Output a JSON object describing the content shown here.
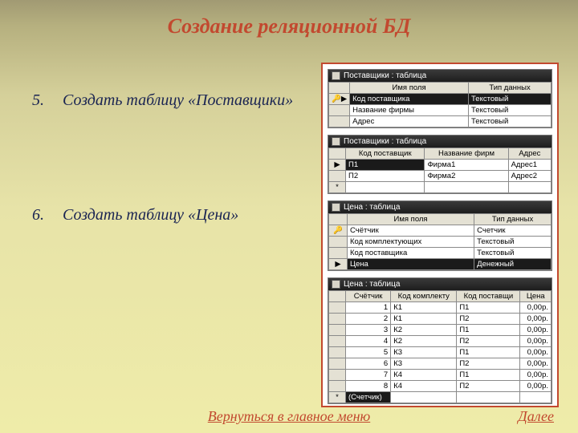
{
  "title": "Создание реляционной БД",
  "steps": [
    {
      "num": "5.",
      "text": "Создать таблицу «Поставщики»"
    },
    {
      "num": "6.",
      "text": "Создать таблицу «Цена»"
    }
  ],
  "nav": {
    "back": "Вернуться в главное меню",
    "next": "Далее"
  },
  "shot1": {
    "caption": "Поставщики : таблица",
    "headers": [
      "",
      "Имя поля",
      "Тип данных"
    ],
    "rows": [
      {
        "icon": "🔑▶",
        "f": "Код поставщика",
        "t": "Текстовый",
        "sel": true
      },
      {
        "icon": "",
        "f": "Название фирмы",
        "t": "Текстовый"
      },
      {
        "icon": "",
        "f": "Адрес",
        "t": "Текстовый"
      }
    ]
  },
  "shot2": {
    "caption": "Поставщики : таблица",
    "headers": [
      "",
      "Код поставщик",
      "Название фирм",
      "Адрес"
    ],
    "rows": [
      {
        "icon": "▶",
        "c": "П1",
        "n": "Фирма1",
        "a": "Адрес1",
        "sel": true
      },
      {
        "icon": "",
        "c": "П2",
        "n": "Фирма2",
        "a": "Адрес2"
      },
      {
        "icon": "*",
        "c": "",
        "n": "",
        "a": ""
      }
    ]
  },
  "shot3": {
    "caption": "Цена : таблица",
    "headers": [
      "",
      "Имя поля",
      "Тип данных"
    ],
    "rows": [
      {
        "icon": "🔑",
        "f": "Счётчик",
        "t": "Счетчик"
      },
      {
        "icon": "",
        "f": "Код комплектующих",
        "t": "Текстовый"
      },
      {
        "icon": "",
        "f": "Код поставщика",
        "t": "Текстовый"
      },
      {
        "icon": "▶",
        "f": "Цена",
        "t": "Денежный",
        "sel": true
      }
    ]
  },
  "shot4": {
    "caption": "Цена : таблица",
    "headers": [
      "",
      "Счётчик",
      "Код комплекту",
      "Код поставщи",
      "Цена"
    ],
    "rows": [
      {
        "i": "",
        "s": "1",
        "k": "К1",
        "p": "П1",
        "c": "0,00р."
      },
      {
        "i": "",
        "s": "2",
        "k": "К1",
        "p": "П2",
        "c": "0,00р."
      },
      {
        "i": "",
        "s": "3",
        "k": "К2",
        "p": "П1",
        "c": "0,00р."
      },
      {
        "i": "",
        "s": "4",
        "k": "К2",
        "p": "П2",
        "c": "0,00р."
      },
      {
        "i": "",
        "s": "5",
        "k": "К3",
        "p": "П1",
        "c": "0,00р."
      },
      {
        "i": "",
        "s": "6",
        "k": "К3",
        "p": "П2",
        "c": "0,00р."
      },
      {
        "i": "",
        "s": "7",
        "k": "К4",
        "p": "П1",
        "c": "0,00р."
      },
      {
        "i": "",
        "s": "8",
        "k": "К4",
        "p": "П2",
        "c": "0,00р."
      },
      {
        "i": "*",
        "s": "(Счетчик)",
        "k": "",
        "p": "",
        "c": "",
        "sel": true
      }
    ]
  }
}
